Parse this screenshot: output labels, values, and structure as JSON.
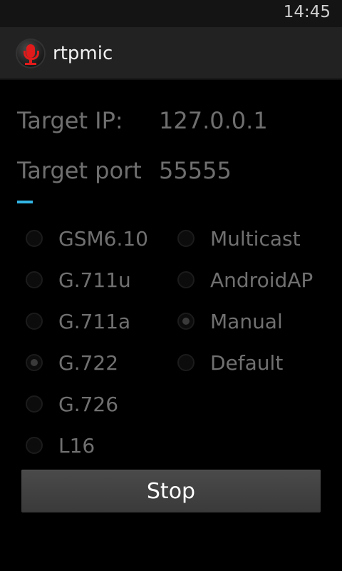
{
  "status_bar": {
    "time": "14:45"
  },
  "action_bar": {
    "title": "rtpmic",
    "icon": "microphone-icon"
  },
  "form": {
    "target_ip_label": "Target IP:",
    "target_ip_value": "127.0.0.1",
    "target_port_label": "Target port",
    "target_port_value": "55555"
  },
  "codecs": [
    {
      "label": "GSM6.10",
      "checked": false
    },
    {
      "label": "G.711u",
      "checked": false
    },
    {
      "label": "G.711a",
      "checked": false
    },
    {
      "label": "G.722",
      "checked": true
    },
    {
      "label": "G.726",
      "checked": false
    },
    {
      "label": "L16",
      "checked": false
    }
  ],
  "destinations": [
    {
      "label": "Multicast",
      "checked": false
    },
    {
      "label": "AndroidAP",
      "checked": false
    },
    {
      "label": "Manual",
      "checked": true
    },
    {
      "label": "Default",
      "checked": false
    }
  ],
  "stop_button": {
    "label": "Stop"
  },
  "colors": {
    "accent": "#33b5e5",
    "mic_red": "#e11b1b"
  }
}
